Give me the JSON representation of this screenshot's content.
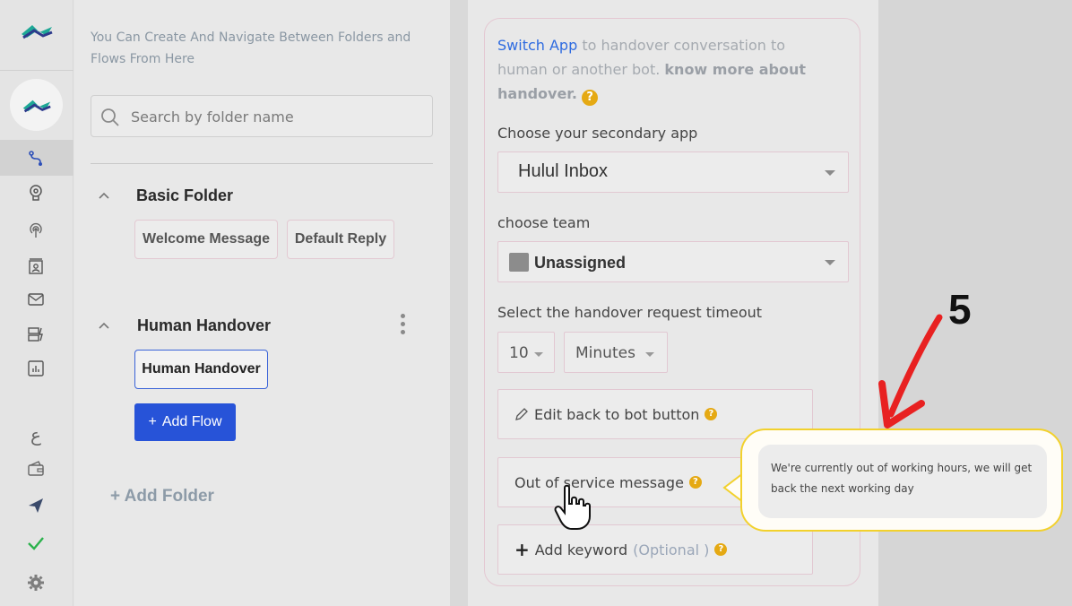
{
  "folders_panel": {
    "hint": "You Can Create And Navigate Between Folders and Flows From Here",
    "search_placeholder": "Search by folder name",
    "folders": [
      {
        "title": "Basic Folder",
        "flows": [
          "Welcome Message",
          "Default Reply"
        ]
      },
      {
        "title": "Human Handover",
        "flows": [
          "Human Handover"
        ]
      }
    ],
    "add_flow_label": "Add Flow",
    "add_folder_label": "+ Add Folder"
  },
  "config": {
    "switch_app_link": "Switch App",
    "desc_text": " to handover conversation to human or another bot. ",
    "know_more": "know more about handover.",
    "secondary_app_label": "Choose your secondary app",
    "secondary_app_value": "Hulul Inbox",
    "team_label": "choose team",
    "team_value": "Unassigned",
    "timeout_label": "Select the handover request timeout",
    "timeout_value": "10",
    "timeout_unit": "Minutes",
    "edit_back_label": "Edit back to bot button",
    "out_of_service_label": "Out of service message",
    "add_keyword_label": "Add keyword",
    "add_keyword_optional": "(Optional )"
  },
  "tooltip": {
    "text": "We're currently out of working hours, we will get back the next working day"
  },
  "annotation": {
    "step": "5"
  },
  "colors": {
    "primary": "#2753d8",
    "link": "#2e6be0",
    "help": "#e5a913",
    "highlight": "#f2d12d",
    "arrow": "#e82121",
    "check": "#2bb24c",
    "brand_teal": "#1ea896",
    "brand_navy": "#2d3a8c"
  },
  "rail_icons": [
    "brand-logo-icon",
    "flows-icon",
    "ai-brain-icon",
    "broadcast-icon",
    "contacts-icon",
    "mail-icon",
    "templates-icon",
    "analytics-icon",
    "language-icon",
    "wallet-icon",
    "send-icon",
    "check-icon",
    "settings-icon"
  ]
}
